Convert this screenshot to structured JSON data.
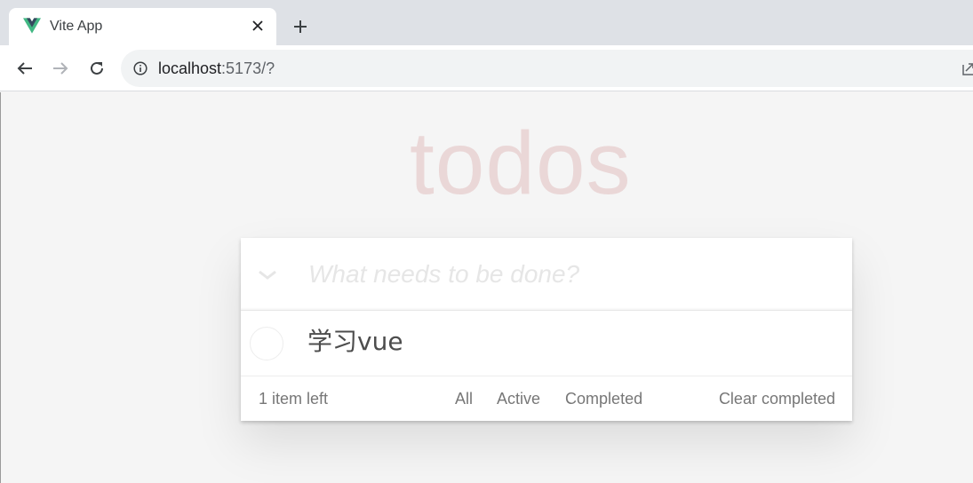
{
  "browser": {
    "tab_title": "Vite App",
    "url_host": "localhost",
    "url_rest": ":5173/?",
    "colors": {
      "vue_green": "#41b883",
      "vue_dark": "#35495e"
    }
  },
  "app": {
    "title": "todos",
    "new_todo_placeholder": "What needs to be done?",
    "todos": [
      {
        "label": "学习vue",
        "completed": false
      }
    ],
    "footer": {
      "count": "1 item left",
      "filters": [
        "All",
        "Active",
        "Completed"
      ],
      "clear": "Clear completed"
    }
  }
}
